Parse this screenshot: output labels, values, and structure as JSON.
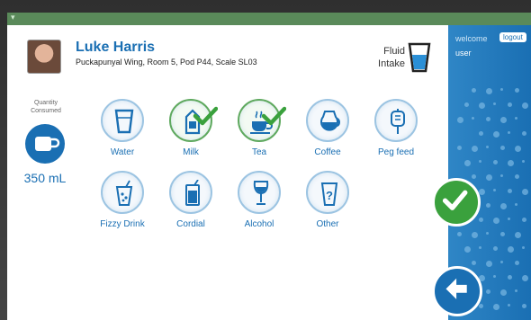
{
  "patient": {
    "name": "Luke Harris",
    "location": "Puckapunyal Wing, Room 5, Pod P44, Scale SL03"
  },
  "header": {
    "fluid_label_line1": "Fluid",
    "fluid_label_line2": "Intake"
  },
  "quantity": {
    "label_line1": "Quantity",
    "label_line2": "Consumed",
    "value": "350 mL"
  },
  "drinks": [
    {
      "label": "Water",
      "selected": false,
      "icon": "glass-icon"
    },
    {
      "label": "Milk",
      "selected": true,
      "icon": "milk-carton-icon"
    },
    {
      "label": "Tea",
      "selected": true,
      "icon": "tea-cup-icon"
    },
    {
      "label": "Coffee",
      "selected": false,
      "icon": "coffee-pot-icon"
    },
    {
      "label": "Peg feed",
      "selected": false,
      "icon": "peg-feed-bag-icon"
    },
    {
      "label": "Fizzy Drink",
      "selected": false,
      "icon": "fizzy-drink-icon"
    },
    {
      "label": "Cordial",
      "selected": false,
      "icon": "cordial-glass-icon"
    },
    {
      "label": "Alcohol",
      "selected": false,
      "icon": "wine-glass-icon"
    },
    {
      "label": "Other",
      "selected": false,
      "icon": "question-cup-icon"
    }
  ],
  "user_panel": {
    "welcome": "welcome",
    "username": "user",
    "logout": "logout"
  },
  "colors": {
    "brand_blue": "#1a6fb3",
    "confirm_green": "#3aa13d",
    "panel_blue": "#2f86c6"
  }
}
